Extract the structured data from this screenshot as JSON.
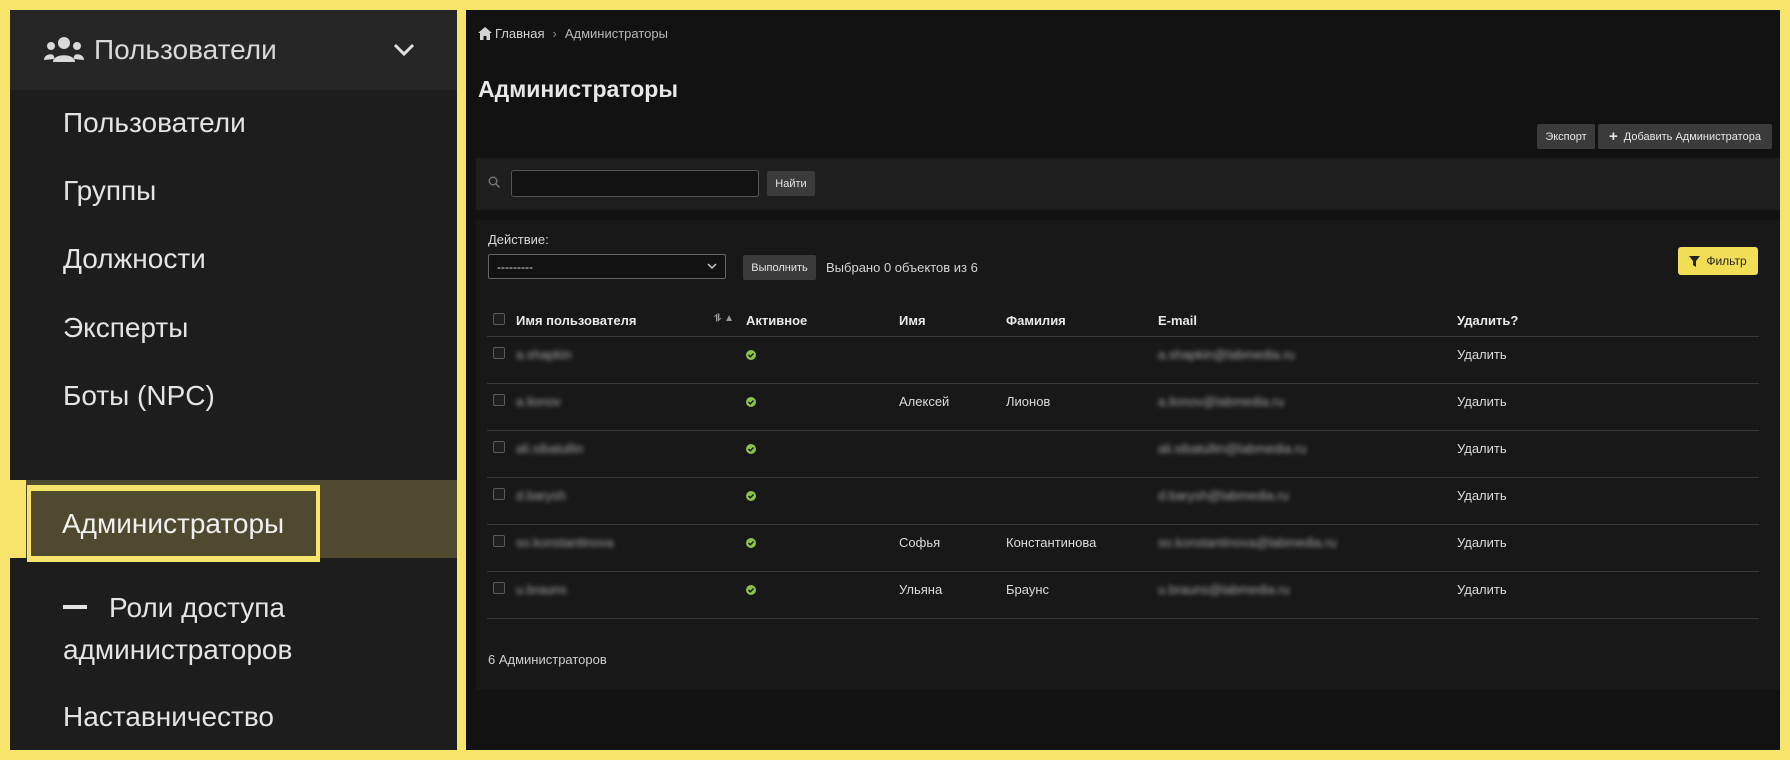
{
  "sidebar": {
    "header_label": "Пользователи",
    "items": [
      {
        "label": "Пользователи"
      },
      {
        "label": "Группы"
      },
      {
        "label": "Должности"
      },
      {
        "label": "Эксперты"
      },
      {
        "label": "Боты (NPC)"
      },
      {
        "label": "Администраторы",
        "active": true
      },
      {
        "label_line1": "Роли доступа",
        "label_line2": "администраторов"
      },
      {
        "label": "Наставничество"
      }
    ]
  },
  "breadcrumb": {
    "home": "Главная",
    "current": "Администраторы"
  },
  "page_title": "Администраторы",
  "toolbar": {
    "export_label": "Экспорт",
    "add_label": "Добавить Администратора"
  },
  "search": {
    "value": "",
    "button_label": "Найти"
  },
  "actions": {
    "label": "Действие:",
    "selected": "---------",
    "run_label": "Выполнить",
    "selected_text": "Выбрано 0 объектов из 6"
  },
  "filter_label": "Фильтр",
  "table": {
    "headers": [
      "Имя пользователя",
      "Активное",
      "Имя",
      "Фамилия",
      "E-mail",
      "Удалить?"
    ],
    "rows": [
      {
        "username": "a.shapkin",
        "first": "",
        "last": "",
        "email": "a.shapkin@labmedia.ru",
        "delete": "Удалить"
      },
      {
        "username": "a.lionov",
        "first": "Алексей",
        "last": "Лионов",
        "email": "a.lionov@labmedia.ru",
        "delete": "Удалить"
      },
      {
        "username": "ali.sibatullin",
        "first": "",
        "last": "",
        "email": "ali.sibatullin@labmedia.ru",
        "delete": "Удалить"
      },
      {
        "username": "d.barysh",
        "first": "",
        "last": "",
        "email": "d.barysh@labmedia.ru",
        "delete": "Удалить"
      },
      {
        "username": "so.konstantinova",
        "first": "Софья",
        "last": "Константинова",
        "email": "so.konstantinova@labmedia.ru",
        "delete": "Удалить"
      },
      {
        "username": "u.brauns",
        "first": "Ульяна",
        "last": "Браунс",
        "email": "u.brauns@labmedia.ru",
        "delete": "Удалить"
      }
    ]
  },
  "total_text": "6 Администраторов",
  "colors": {
    "accent": "#f7e46a",
    "active_icon": "#8bc34a",
    "sidebar_bg": "#1d1d1d",
    "main_bg": "#121212"
  }
}
